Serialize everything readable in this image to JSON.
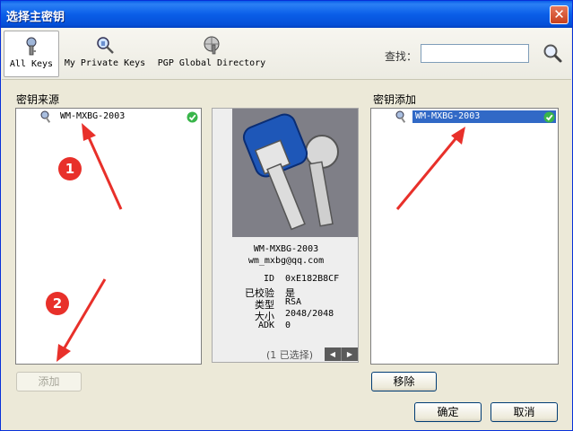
{
  "window": {
    "title": "选择主密钥",
    "close_glyph": "✕"
  },
  "toolbar": {
    "tabs": [
      {
        "label": "All Keys",
        "icon": "key-ring-icon",
        "active": true
      },
      {
        "label": "My Private Keys",
        "icon": "magnifier-key-icon",
        "active": false
      },
      {
        "label": "PGP Global Directory",
        "icon": "globe-key-icon",
        "active": false
      }
    ],
    "search_label": "查找：",
    "search_value": "",
    "search_icon": "search-icon"
  },
  "source": {
    "label": "密钥来源",
    "items": [
      {
        "name": "WM-MXBG-2003",
        "verified": true
      }
    ]
  },
  "target": {
    "label": "密钥添加",
    "items": [
      {
        "name": "WM-MXBG-2003",
        "verified": true,
        "selected": true
      }
    ]
  },
  "detail": {
    "key_name": "WM-MXBG-2003",
    "email": "wm_mxbg@qq.com",
    "props": [
      {
        "k": "ID",
        "v": "0xE182B8CF"
      },
      {
        "k": "已校验",
        "v": "是"
      },
      {
        "k": "类型",
        "v": "RSA"
      },
      {
        "k": "大小",
        "v": "2048/2048"
      },
      {
        "k": "ADK",
        "v": "0"
      }
    ],
    "selected_count": "(1 已选择)",
    "pager_prev": "◀",
    "pager_next": "▶"
  },
  "buttons": {
    "add": "添加",
    "remove": "移除",
    "ok": "确定",
    "cancel": "取消"
  },
  "annotations": {
    "marker1": "1",
    "marker2": "2"
  },
  "colors": {
    "accent": "#3169c6",
    "annotation_red": "#e8302a",
    "title_blue": "#0a5ee8"
  }
}
